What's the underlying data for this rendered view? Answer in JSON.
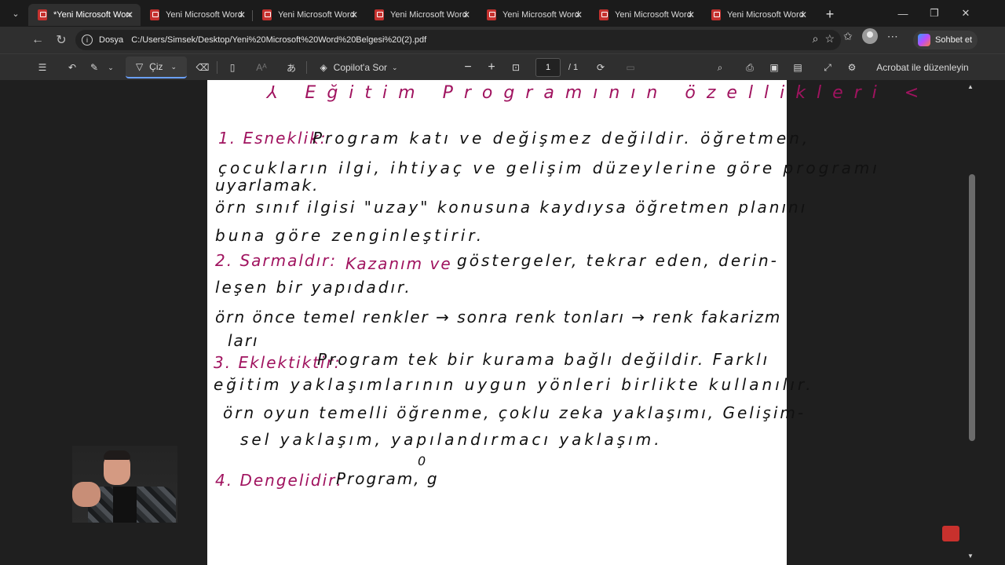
{
  "browser": {
    "tabs": [
      {
        "title": "*Yeni Microsoft Word",
        "active": true
      },
      {
        "title": "Yeni Microsoft Word",
        "active": false
      },
      {
        "title": "Yeni Microsoft Word",
        "active": false
      },
      {
        "title": "Yeni Microsoft Word",
        "active": false
      },
      {
        "title": "Yeni Microsoft Word",
        "active": false
      },
      {
        "title": "Yeni Microsoft Word",
        "active": false
      },
      {
        "title": "Yeni Microsoft Word",
        "active": false
      }
    ],
    "address_label": "Dosya",
    "url": "C:/Users/Simsek/Desktop/Yeni%20Microsoft%20Word%20Belgesi%20(2).pdf",
    "chat_label": "Sohbet et"
  },
  "pdf_toolbar": {
    "draw_label": "Çiz",
    "copilot_label": "Copilot'a Sor",
    "page_current": "1",
    "page_total": "/ 1",
    "edit_label": "Acrobat ile düzenleyin"
  },
  "document": {
    "lines": [
      {
        "text": "⅄ Eğitim Programının özellikleri <",
        "color": "red"
      },
      {
        "text": "1. Esneklik:",
        "color": "red"
      },
      {
        "text": "Program katı ve değişmez değildir. öğretmen,",
        "color": "black"
      },
      {
        "text": "çocukların ilgi, ihtiyaç ve gelişim düzeylerine göre programı",
        "color": "black"
      },
      {
        "text": "uyarlamak.",
        "color": "black"
      },
      {
        "text": "örn sınıf ilgisi \"uzay\" konusuna kaydıysa öğretmen planını",
        "color": "black"
      },
      {
        "text": "buna göre zenginleştirir.",
        "color": "black"
      },
      {
        "text": "2. Sarmaldır:",
        "color": "red"
      },
      {
        "text": "Kazanım ve",
        "color": "red"
      },
      {
        "text": "göstergeler, tekrar eden, derin-",
        "color": "black"
      },
      {
        "text": "leşen bir yapıdadır.",
        "color": "black"
      },
      {
        "text": "örn önce temel renkler → sonra renk tonları → renk fakarizm",
        "color": "black"
      },
      {
        "text": "ları",
        "color": "black"
      },
      {
        "text": "3. Eklektiktir:",
        "color": "red"
      },
      {
        "text": "Program tek bir kurama bağlı değildir. Farklı",
        "color": "black"
      },
      {
        "text": "eğitim yaklaşımlarının uygun yönleri birlikte kullanılır.",
        "color": "black"
      },
      {
        "text": "örn oyun temelli öğrenme, çoklu zeka yaklaşımı, Gelişim-",
        "color": "black"
      },
      {
        "text": "sel yaklaşım, yapılandırmacı yaklaşım.",
        "color": "black"
      },
      {
        "text": "0",
        "color": "black"
      },
      {
        "text": "4. Dengelidir:",
        "color": "red"
      },
      {
        "text": "Program, g",
        "color": "black"
      }
    ]
  }
}
